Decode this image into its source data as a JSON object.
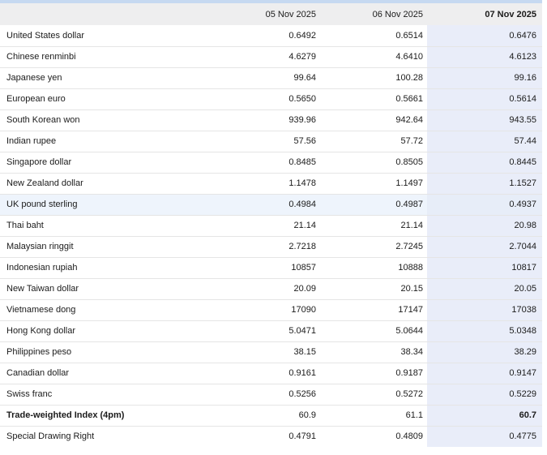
{
  "theme": {
    "top_bar_color": "#c6d9f1",
    "header_bg": "#eeeeef",
    "highlight_column_bg": "#e9edf9",
    "highlight_row_bg": "#eef4fc",
    "highlight_intersection_bg": "#e7edf8",
    "divider_color": "#e5e5e5",
    "text_color": "#1b1b1b"
  },
  "table": {
    "columns": [
      "",
      "05 Nov 2025",
      "06 Nov 2025",
      "07 Nov 2025"
    ],
    "highlighted_column": "07 Nov 2025",
    "highlighted_row": "UK pound sterling",
    "rows": [
      {
        "label": "United States dollar",
        "values": [
          "0.6492",
          "0.6514",
          "0.6476"
        ]
      },
      {
        "label": "Chinese renminbi",
        "values": [
          "4.6279",
          "4.6410",
          "4.6123"
        ]
      },
      {
        "label": "Japanese yen",
        "values": [
          "99.64",
          "100.28",
          "99.16"
        ]
      },
      {
        "label": "European euro",
        "values": [
          "0.5650",
          "0.5661",
          "0.5614"
        ]
      },
      {
        "label": "South Korean won",
        "values": [
          "939.96",
          "942.64",
          "943.55"
        ]
      },
      {
        "label": "Indian rupee",
        "values": [
          "57.56",
          "57.72",
          "57.44"
        ]
      },
      {
        "label": "Singapore dollar",
        "values": [
          "0.8485",
          "0.8505",
          "0.8445"
        ]
      },
      {
        "label": "New Zealand dollar",
        "values": [
          "1.1478",
          "1.1497",
          "1.1527"
        ]
      },
      {
        "label": "UK pound sterling",
        "values": [
          "0.4984",
          "0.4987",
          "0.4937"
        ],
        "highlight": true
      },
      {
        "label": "Thai baht",
        "values": [
          "21.14",
          "21.14",
          "20.98"
        ]
      },
      {
        "label": "Malaysian ringgit",
        "values": [
          "2.7218",
          "2.7245",
          "2.7044"
        ]
      },
      {
        "label": "Indonesian rupiah",
        "values": [
          "10857",
          "10888",
          "10817"
        ]
      },
      {
        "label": "New Taiwan dollar",
        "values": [
          "20.09",
          "20.15",
          "20.05"
        ]
      },
      {
        "label": "Vietnamese dong",
        "values": [
          "17090",
          "17147",
          "17038"
        ]
      },
      {
        "label": "Hong Kong dollar",
        "values": [
          "5.0471",
          "5.0644",
          "5.0348"
        ]
      },
      {
        "label": "Philippines peso",
        "values": [
          "38.15",
          "38.34",
          "38.29"
        ]
      },
      {
        "label": "Canadian dollar",
        "values": [
          "0.9161",
          "0.9187",
          "0.9147"
        ]
      },
      {
        "label": "Swiss franc",
        "values": [
          "0.5256",
          "0.5272",
          "0.5229"
        ]
      },
      {
        "label": "Trade-weighted Index (4pm)",
        "values": [
          "60.9",
          "61.1",
          "60.7"
        ],
        "emphasis": true
      },
      {
        "label": "Special Drawing Right",
        "values": [
          "0.4791",
          "0.4809",
          "0.4775"
        ]
      }
    ]
  }
}
